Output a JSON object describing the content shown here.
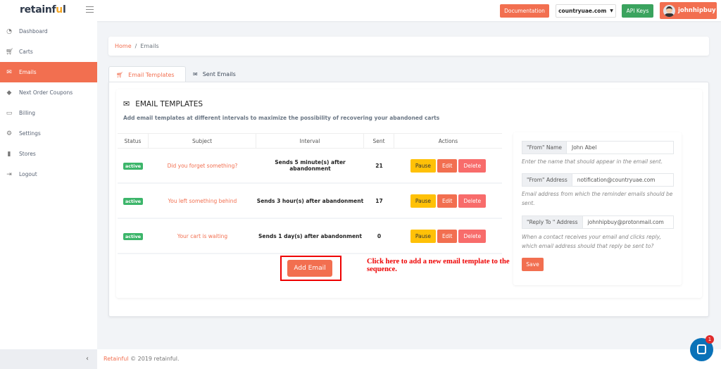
{
  "header": {
    "logo": "retainful",
    "documentation": "Documentation",
    "store_select": "countryuae.com",
    "api_keys": "API Keys",
    "user": "johnhipbuy"
  },
  "sidebar": {
    "items": [
      {
        "label": "Dashboard",
        "icon": "dashboard-icon"
      },
      {
        "label": "Carts",
        "icon": "cart-icon"
      },
      {
        "label": "Emails",
        "icon": "envelope-icon",
        "active": true
      },
      {
        "label": "Next Order Coupons",
        "icon": "tags-icon"
      },
      {
        "label": "Billing",
        "icon": "credit-card-icon"
      },
      {
        "label": "Settings",
        "icon": "gear-icon"
      },
      {
        "label": "Stores",
        "icon": "store-icon"
      },
      {
        "label": "Logout",
        "icon": "logout-icon"
      }
    ],
    "collapse": "‹"
  },
  "breadcrumb": {
    "home": "Home",
    "sep": "/",
    "current": "Emails"
  },
  "tabs": [
    {
      "label": "Email Templates"
    },
    {
      "label": "Sent Emails"
    }
  ],
  "section": {
    "title": "EMAIL TEMPLATES",
    "subtitle": "Add email templates at different intervals to maximize the possibility of recovering your abandoned carts"
  },
  "table": {
    "headers": [
      "Status",
      "Subject",
      "Interval",
      "Sent",
      "Actions"
    ],
    "rows": [
      {
        "status": "active",
        "subject": "Did you forget something?",
        "interval": "Sends 5 minute(s) after abandonment",
        "sent": "21"
      },
      {
        "status": "active",
        "subject": "You left something behind",
        "interval": "Sends 3 hour(s) after abandonment",
        "sent": "17"
      },
      {
        "status": "active",
        "subject": "Your cart is waiting",
        "interval": "Sends 1 day(s) after abandonment",
        "sent": "0"
      }
    ],
    "actions": {
      "pause": "Pause",
      "edit": "Edit",
      "delete": "Delete"
    }
  },
  "add_email": "Add Email",
  "annotation": "Click here to add a new email template to the sequence.",
  "form": {
    "from_name_label": "\"From\" Name",
    "from_name": "John Abel",
    "from_name_help": "Enter the name that should appear in the email sent.",
    "from_address_label": "\"From\" Address",
    "from_address": "notification@countryuae.com",
    "from_address_help": "Email address from which the reminder emails should be sent.",
    "reply_label": "\"Reply To \" Address",
    "reply": "johnhipbuy@protonmail.com",
    "reply_help": "When a contact receives your email and clicks reply, which email address should that reply be sent to?",
    "save": "Save"
  },
  "footer": {
    "brand": "Retainful",
    "text": "© 2019 retainful."
  },
  "chat": {
    "badge": "1"
  },
  "colors": {
    "accent": "#f26f50",
    "green": "#3aa35e",
    "warning": "#ffc107",
    "danger": "#f86c6b"
  }
}
